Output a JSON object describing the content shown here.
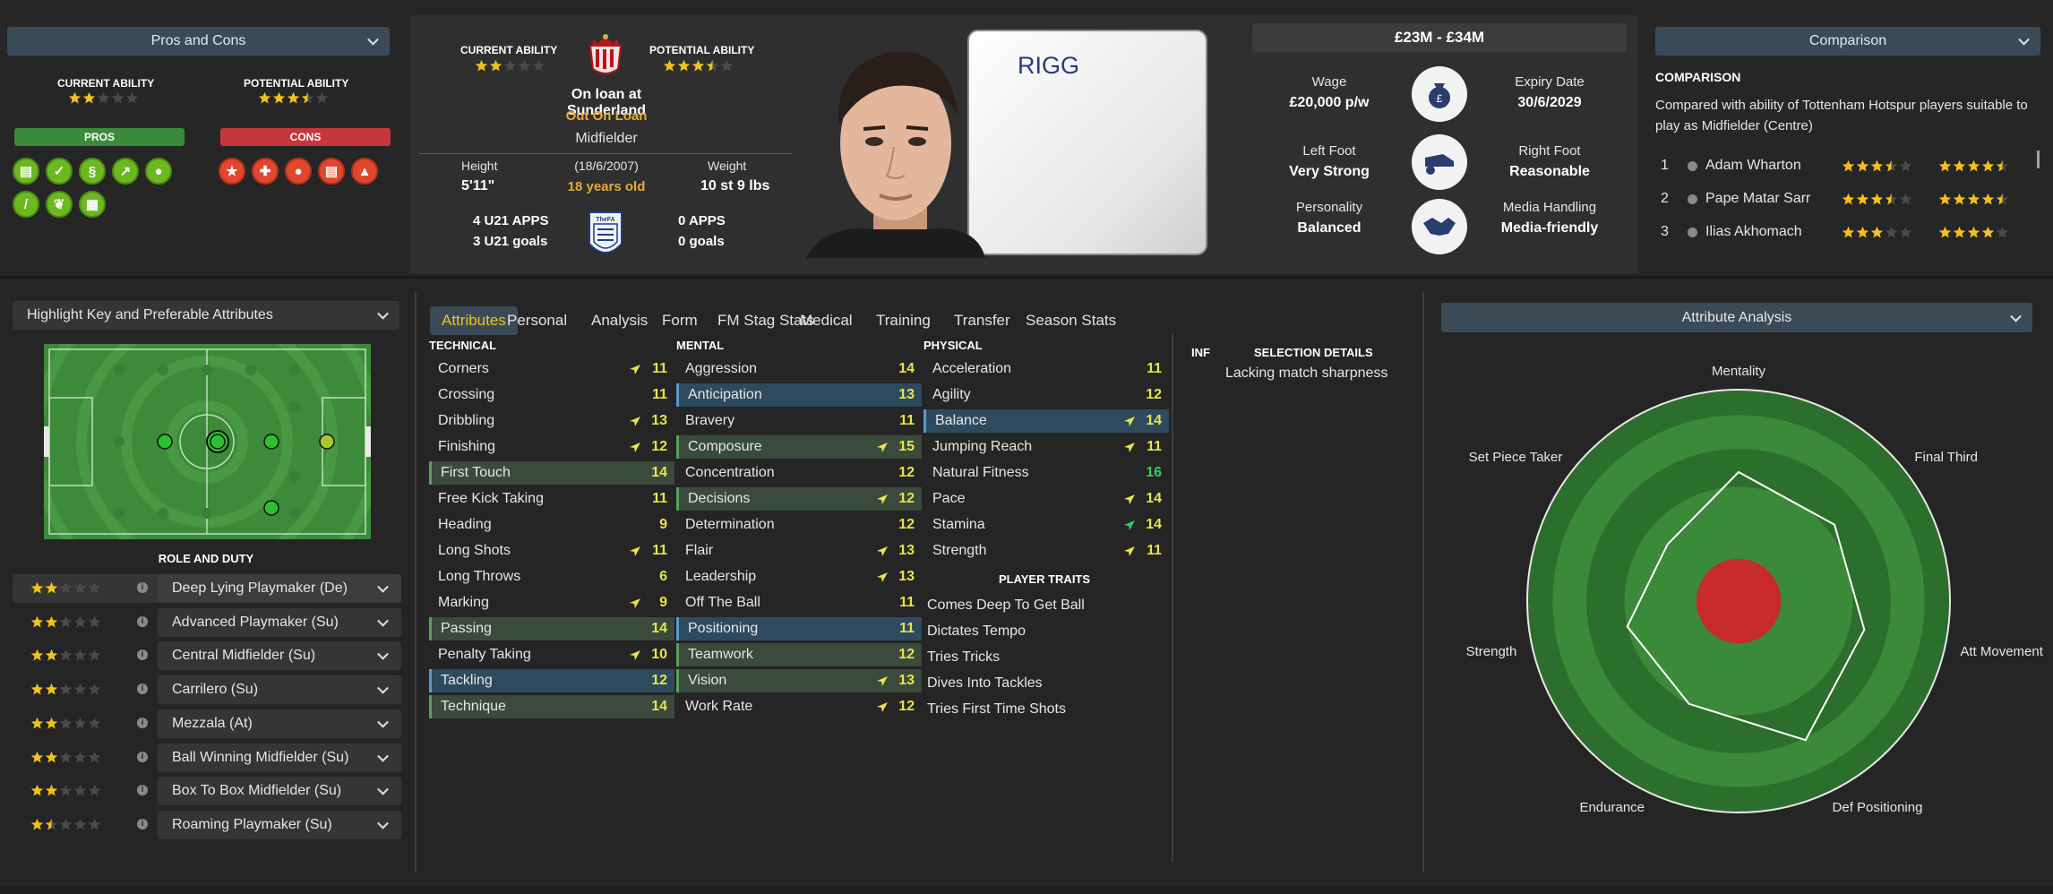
{
  "pros_cons_panel": {
    "dropdown_label": "Pros and Cons",
    "current_ability_label": "CURRENT ABILITY",
    "potential_ability_label": "POTENTIAL ABILITY",
    "current_ability_stars": 2,
    "potential_ability_stars": 3.5,
    "pros_label": "PROS",
    "cons_label": "CONS",
    "pros_icons": [
      "document-icon",
      "document-check-icon",
      "dna-icon",
      "trend-up-icon",
      "head-brain-icon",
      "bandage-icon",
      "leaf-icon",
      "clipboard-icon"
    ],
    "cons_icons": [
      "star-icon",
      "medical-cross-icon",
      "footprint-icon",
      "contract-icon",
      "flask-icon"
    ]
  },
  "player_card": {
    "current_ability_label": "CURRENT ABILITY",
    "potential_ability_label": "POTENTIAL ABILITY",
    "current_ability_stars": 2,
    "potential_ability_stars": 3.5,
    "loan_status": "On loan at Sunderland",
    "loan_tag": "Out On Loan",
    "position": "Midfielder",
    "height_label": "Height",
    "height_value": "5'11\"",
    "dob": "(18/6/2007)",
    "age": "18 years old",
    "weight_label": "Weight",
    "weight_value": "10 st 9 lbs",
    "u21_apps": "4 U21 APPS",
    "u21_goals": "3 U21 goals",
    "apps": "0 APPS",
    "goals": "0 goals",
    "fa_badge_text": "TheFA",
    "player_name": "RIGG"
  },
  "contract_card": {
    "value_range": "£23M - £34M",
    "wage_label": "Wage",
    "wage_value": "£20,000 p/w",
    "expiry_label": "Expiry Date",
    "expiry_value": "30/6/2029",
    "left_foot_label": "Left Foot",
    "left_foot_value": "Very Strong",
    "right_foot_label": "Right Foot",
    "right_foot_value": "Reasonable",
    "personality_label": "Personality",
    "personality_value": "Balanced",
    "media_label": "Media Handling",
    "media_value": "Media-friendly"
  },
  "comparison": {
    "dropdown_label": "Comparison",
    "heading": "COMPARISON",
    "description": "Compared with ability of Tottenham Hotspur players suitable to play as Midfielder (Centre)",
    "rows": [
      {
        "rank": "1",
        "name": "Adam Wharton",
        "ca": 3.5,
        "pa": 4.5
      },
      {
        "rank": "2",
        "name": "Pape Matar Sarr",
        "ca": 3.5,
        "pa": 4.5
      },
      {
        "rank": "3",
        "name": "Ilias Akhomach",
        "ca": 3,
        "pa": 4
      }
    ]
  },
  "left_panel": {
    "highlight_dropdown": "Highlight Key and Preferable Attributes",
    "role_and_duty_label": "ROLE AND DUTY",
    "roles": [
      {
        "name": "Deep Lying Playmaker (De)",
        "stars": 2
      },
      {
        "name": "Advanced Playmaker (Su)",
        "stars": 2
      },
      {
        "name": "Central Midfielder (Su)",
        "stars": 2
      },
      {
        "name": "Carrilero (Su)",
        "stars": 2
      },
      {
        "name": "Mezzala (At)",
        "stars": 2
      },
      {
        "name": "Ball Winning Midfielder (Su)",
        "stars": 2
      },
      {
        "name": "Box To Box Midfielder (Su)",
        "stars": 2
      },
      {
        "name": "Roaming Playmaker (Su)",
        "stars": 1.5
      }
    ],
    "info_glyph": "i"
  },
  "tabs": [
    "Attributes",
    "Personal",
    "Analysis",
    "Form",
    "FM Stag Stats",
    "Medical",
    "Training",
    "Transfer",
    "Season Stats"
  ],
  "attributes": {
    "technical_label": "TECHNICAL",
    "mental_label": "MENTAL",
    "physical_label": "PHYSICAL",
    "technical": [
      {
        "name": "Corners",
        "value": "11",
        "trend": "up"
      },
      {
        "name": "Crossing",
        "value": "11",
        "trend": ""
      },
      {
        "name": "Dribbling",
        "value": "13",
        "trend": "up"
      },
      {
        "name": "Finishing",
        "value": "12",
        "trend": "up"
      },
      {
        "name": "First Touch",
        "value": "14",
        "trend": "",
        "hl": "green"
      },
      {
        "name": "Free Kick Taking",
        "value": "11",
        "trend": ""
      },
      {
        "name": "Heading",
        "value": "9",
        "trend": ""
      },
      {
        "name": "Long Shots",
        "value": "11",
        "trend": "up"
      },
      {
        "name": "Long Throws",
        "value": "6",
        "trend": ""
      },
      {
        "name": "Marking",
        "value": "9",
        "trend": "up"
      },
      {
        "name": "Passing",
        "value": "14",
        "trend": "",
        "hl": "green"
      },
      {
        "name": "Penalty Taking",
        "value": "10",
        "trend": "up"
      },
      {
        "name": "Tackling",
        "value": "12",
        "trend": "",
        "hl": "blue"
      },
      {
        "name": "Technique",
        "value": "14",
        "trend": "",
        "hl": "green"
      }
    ],
    "mental": [
      {
        "name": "Aggression",
        "value": "14",
        "trend": ""
      },
      {
        "name": "Anticipation",
        "value": "13",
        "trend": "",
        "hl": "blue"
      },
      {
        "name": "Bravery",
        "value": "11",
        "trend": ""
      },
      {
        "name": "Composure",
        "value": "15",
        "trend": "up",
        "hl": "green"
      },
      {
        "name": "Concentration",
        "value": "12",
        "trend": ""
      },
      {
        "name": "Decisions",
        "value": "12",
        "trend": "up",
        "hl": "green"
      },
      {
        "name": "Determination",
        "value": "12",
        "trend": ""
      },
      {
        "name": "Flair",
        "value": "13",
        "trend": "up"
      },
      {
        "name": "Leadership",
        "value": "13",
        "trend": "up"
      },
      {
        "name": "Off The Ball",
        "value": "11",
        "trend": ""
      },
      {
        "name": "Positioning",
        "value": "11",
        "trend": "",
        "hl": "blue"
      },
      {
        "name": "Teamwork",
        "value": "12",
        "trend": "",
        "hl": "green"
      },
      {
        "name": "Vision",
        "value": "13",
        "trend": "up",
        "hl": "green"
      },
      {
        "name": "Work Rate",
        "value": "12",
        "trend": "up"
      }
    ],
    "physical": [
      {
        "name": "Acceleration",
        "value": "11",
        "trend": ""
      },
      {
        "name": "Agility",
        "value": "12",
        "trend": ""
      },
      {
        "name": "Balance",
        "value": "14",
        "trend": "up",
        "hl": "blue"
      },
      {
        "name": "Jumping Reach",
        "value": "11",
        "trend": "up"
      },
      {
        "name": "Natural Fitness",
        "value": "16",
        "trend": "",
        "color": "#35d05a"
      },
      {
        "name": "Pace",
        "value": "14",
        "trend": "up"
      },
      {
        "name": "Stamina",
        "value": "14",
        "trend": "upgreen"
      },
      {
        "name": "Strength",
        "value": "11",
        "trend": "up"
      }
    ],
    "player_traits_label": "PLAYER TRAITS",
    "traits": [
      "Comes Deep To Get Ball",
      "Dictates Tempo",
      "Tries Tricks",
      "Dives Into Tackles",
      "Tries First Time Shots"
    ]
  },
  "selection": {
    "inf_label": "INF",
    "heading": "SELECTION DETAILS",
    "text": "Lacking match sharpness"
  },
  "attribute_analysis": {
    "dropdown_label": "Attribute Analysis",
    "axes": [
      "Mentality",
      "Final Third",
      "Att Movement",
      "Def Positioning",
      "Endurance",
      "Strength",
      "Set Piece Taker"
    ],
    "values": [
      0.61,
      0.58,
      0.61,
      0.73,
      0.54,
      0.54,
      0.43
    ]
  },
  "colors": {
    "accent_yellow": "#f0c21c",
    "loan_orange": "#e8a93a",
    "pros_green": "#3a8a3a",
    "cons_red": "#c7363a",
    "value_yellow": "#e8e44a"
  }
}
